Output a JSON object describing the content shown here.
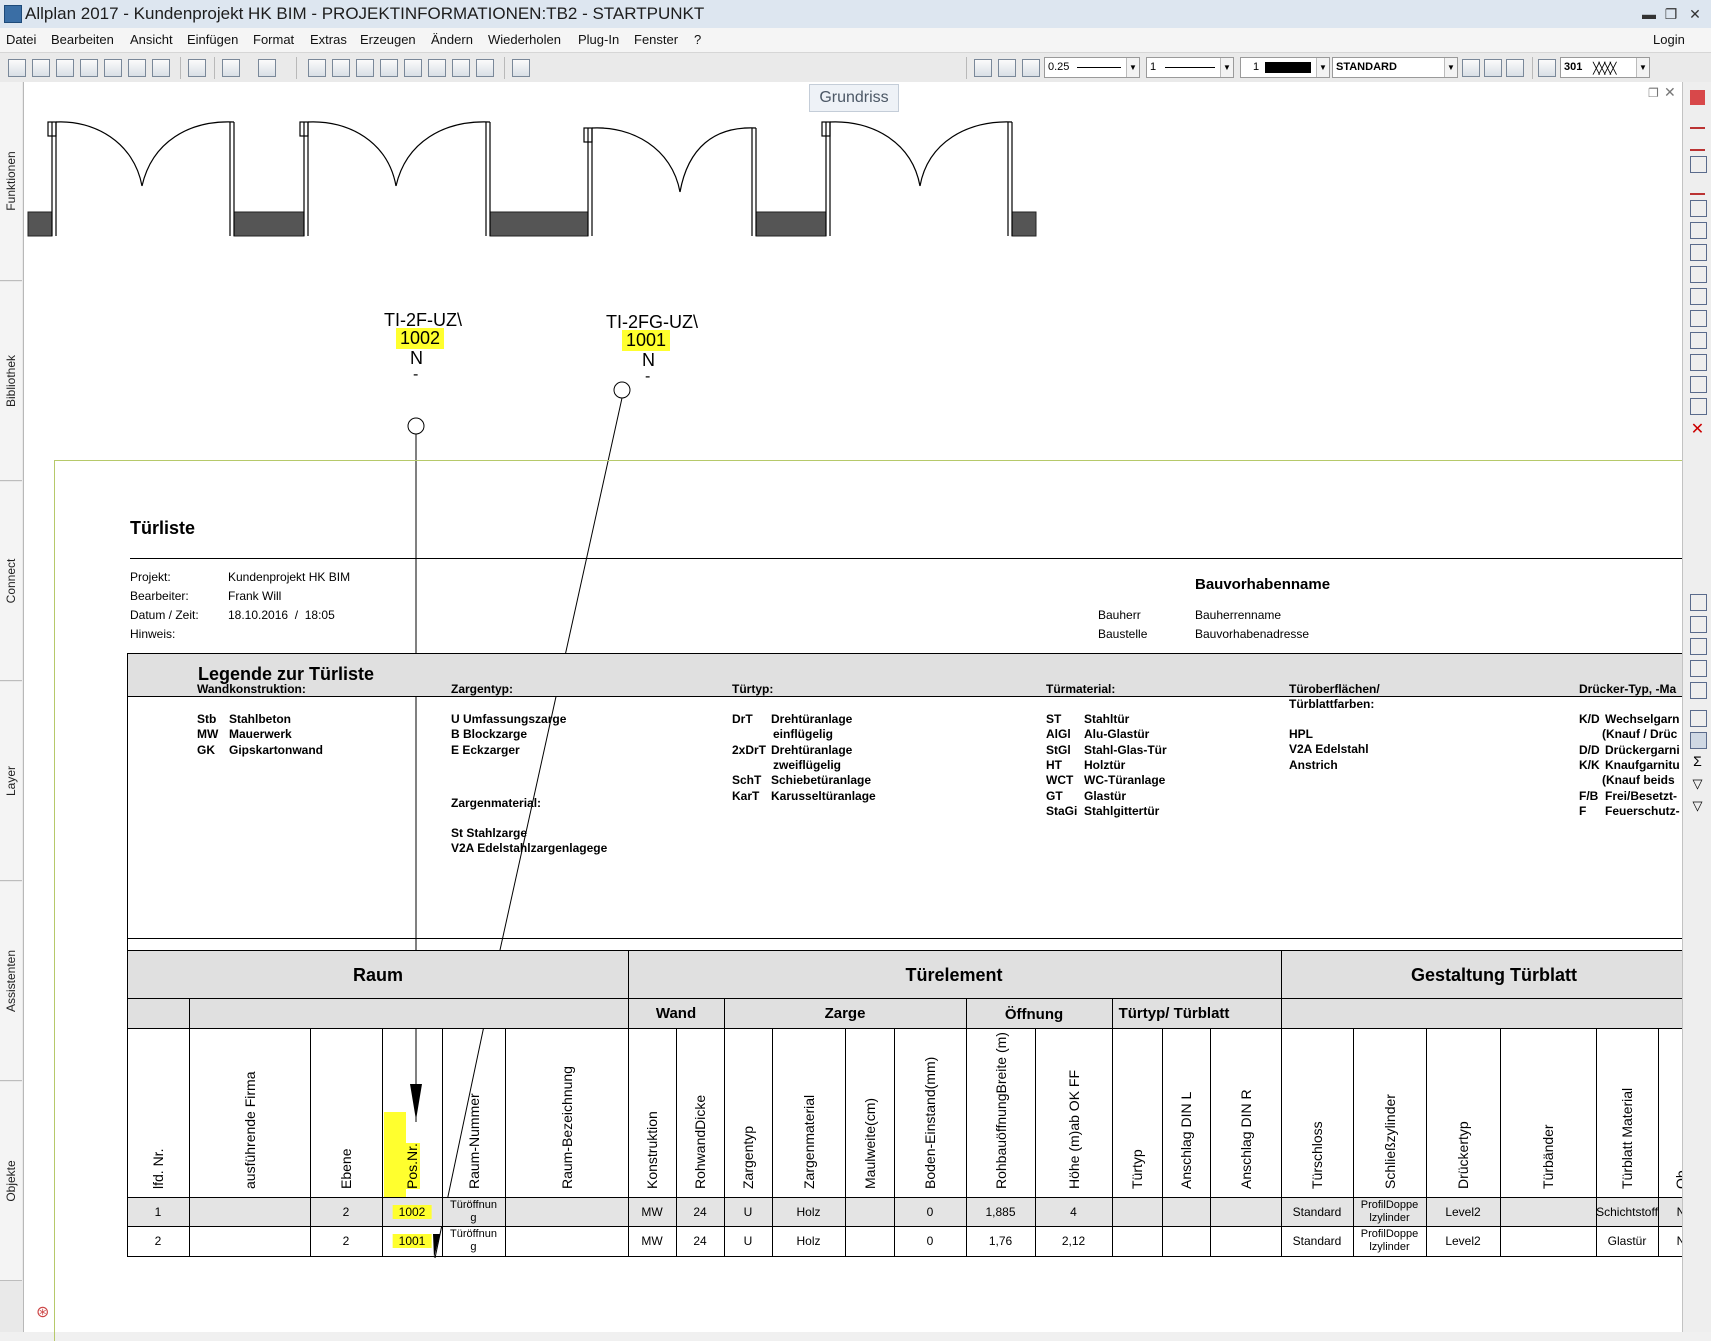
{
  "window": {
    "title": "Allplan 2017 - Kundenprojekt HK BIM - PROJEKTINFORMATIONEN:TB2 - STARTPUNKT",
    "minimize": "▬",
    "restore": "❐",
    "close": "✕"
  },
  "menu": {
    "items": [
      "Datei",
      "Bearbeiten",
      "Ansicht",
      "Einfügen",
      "Format",
      "Extras",
      "Erzeugen",
      "Ändern",
      "Wiederholen",
      "Plug-In",
      "Fenster",
      "?"
    ],
    "login": "Login"
  },
  "toolbar": {
    "pen_thickness": "0.25",
    "line_type": "1",
    "color_number": "1",
    "layer": "STANDARD",
    "pattern_number": "301"
  },
  "sidebar": {
    "tabs": [
      "Funktionen",
      "Bibliothek",
      "Connect",
      "Layer",
      "Assistenten",
      "Objekte"
    ]
  },
  "view": {
    "label": "Grundriss"
  },
  "drawing": {
    "door_tags": [
      {
        "code": "TI-2F-UZ\\",
        "number": "1002",
        "n": "N",
        "dash": "-"
      },
      {
        "code": "TI-2FG-UZ\\",
        "number": "1001",
        "n": "N",
        "dash": "-"
      }
    ]
  },
  "sheet": {
    "title": "Türliste",
    "project_label": "Projekt:",
    "project_value": "Kundenprojekt HK BIM",
    "editor_label": "Bearbeiter:",
    "editor_value": "Frank Will",
    "date_label": "Datum / Zeit:",
    "date_value": "18.10.2016  /  18:05",
    "note_label": "Hinweis:",
    "building_name": "Bauvorhabenname",
    "client_label": "Bauherr",
    "client_value": "Bauherrenname",
    "site_label": "Baustelle",
    "site_value": "Bauvorhabenadresse",
    "legend_title": "Legende zur Türliste",
    "legend": {
      "wall_title": "Wandkonstruktion:",
      "wall_items": [
        [
          "Stb",
          "Stahlbeton"
        ],
        [
          "MW",
          "Mauerwerk"
        ],
        [
          "GK",
          "Gipskartonwand"
        ]
      ],
      "frame_title": "Zargentyp:",
      "frame_items": [
        "U Umfassungszarge",
        "B Blockzarge",
        "E Eckzarger"
      ],
      "frame_material_title": "Zargenmaterial:",
      "frame_material_items": [
        "St Stahlzarge",
        "V2A Edelstahlzargenlagege"
      ],
      "door_type_title": "Türtyp:",
      "door_type_items": [
        [
          "DrT",
          "Drehtüranlage"
        ],
        [
          "",
          "einflügelig"
        ],
        [
          "2xDrT",
          "Drehtüranlage"
        ],
        [
          "",
          "zweiflügelig"
        ],
        [
          "SchT",
          "Schiebetüranlage"
        ],
        [
          "KarT",
          "Karusseltüranlage"
        ]
      ],
      "door_material_title": "Türmaterial:",
      "door_material_items": [
        [
          "ST",
          "Stahltür"
        ],
        [
          "AlGl",
          "Alu-Glastür"
        ],
        [
          "StGl",
          "Stahl-Glas-Tür"
        ],
        [
          "HT",
          "Holztür"
        ],
        [
          "WCT",
          "WC-Türanlage"
        ],
        [
          "GT",
          "Glastür"
        ],
        [
          "StaGi",
          "Stahlgittertür"
        ]
      ],
      "surface_title_1": "Türoberflächen/",
      "surface_title_2": "Türblattfarben:",
      "surface_items": [
        "HPL",
        "V2A Edelstahl",
        "Anstrich"
      ],
      "handle_title": "Drücker-Typ, -Ma",
      "handle_items": [
        [
          "K/D",
          "Wechselgarn"
        ],
        [
          "",
          "(Knauf / Drüc"
        ],
        [
          "D/D",
          "Drückergarni"
        ],
        [
          "K/K",
          "Knaufgarnitu"
        ],
        [
          "",
          "(Knauf beids"
        ],
        [
          "F/B",
          "Frei/Besetzt-"
        ],
        [
          "F",
          "Feuerschutz-"
        ]
      ]
    },
    "groups": {
      "raum": "Raum",
      "tuerelement": "Türelement",
      "gestaltung": "Gestaltung Türblatt",
      "wand": "Wand",
      "zarge": "Zarge",
      "oeffnung": "Öffnung",
      "tuertyp": "Türtyp/ Türblatt"
    },
    "columns": [
      "lfd. Nr.",
      "ausführende Firma",
      "Ebene",
      "Pos.Nr.",
      "Raum-Nummer",
      "Raum-Bezeichnung",
      "Konstruktion",
      "RohwandDicke",
      "Zargentyp",
      "Zargenmaterial",
      "Maulweite(cm)",
      "Boden-Einstand(mm)",
      "RohbauöffnungBreite (m)",
      "Höhe (m)ab OK FF",
      "Türtyp",
      "Anschlag DIN L",
      "Anschlag DIN R",
      "Türschloss",
      "Schließzylinder",
      "Drückertyp",
      "Türbänder",
      "Türblatt Material",
      "Ob"
    ],
    "rows": [
      [
        "1",
        "",
        "2",
        "1002",
        "Türöffnun\ng",
        "",
        "MW",
        "24",
        "U",
        "Holz",
        "",
        "0",
        "1,885",
        "4",
        "",
        "",
        "",
        "Standard",
        "ProfilDoppe\nlzylinder",
        "Level2",
        "",
        "Schichtstoff",
        "N"
      ],
      [
        "2",
        "",
        "2",
        "1001",
        "Türöffnun\ng",
        "",
        "MW",
        "24",
        "U",
        "Holz",
        "",
        "0",
        "1,76",
        "2,12",
        "",
        "",
        "",
        "Standard",
        "ProfilDoppe\nlzylinder",
        "Level2",
        "",
        "Glastür",
        "N"
      ]
    ]
  },
  "colors": {
    "highlight": "#ffff2e",
    "band": "#e0e0e0",
    "frame_line": "#b6c96a",
    "wall": "#555555"
  }
}
